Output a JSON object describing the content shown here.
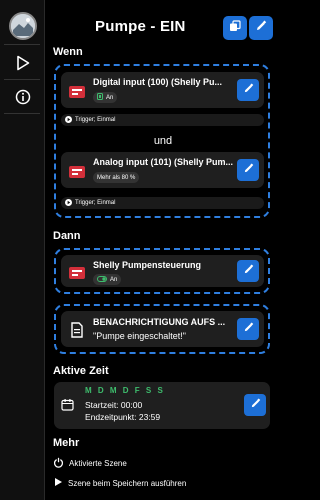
{
  "header": {
    "title": "Pumpe - EIN"
  },
  "sections": {
    "wenn": "Wenn",
    "dann": "Dann",
    "aktive_zeit": "Aktive Zeit",
    "mehr": "Mehr"
  },
  "conditions": [
    {
      "title": "Digital input (100) (Shelly Pu...",
      "badge": "An",
      "trigger": "Trigger; Einmal"
    },
    {
      "title": "Analog input (101) (Shelly Pum...",
      "badge": "Mehr als 80 %",
      "trigger": "Trigger; Einmal"
    }
  ],
  "connector": "und",
  "actions": [
    {
      "title": "Shelly Pumpensteuerung",
      "badge": "An"
    },
    {
      "title": "BENACHRICHTIGUNG AUFS ...",
      "subtitle": "\"Pumpe eingeschaltet!\""
    }
  ],
  "schedule": {
    "days": "M D M D F S S",
    "start": "Startzeit: 00:00",
    "end": "Endzeitpunkt: 23:59"
  },
  "more": {
    "activated": "Aktivierte Szene",
    "run_on_save": "Szene beim Speichern ausführen"
  },
  "colors": {
    "accent": "#1d6fd6",
    "dash": "#2f7fe0",
    "green": "#3ebd6d",
    "card": "#1f1f1f"
  },
  "icons": {
    "copy": "copy-icon",
    "edit": "pencil-icon",
    "play": "play-icon",
    "info": "info-icon",
    "power": "power-icon",
    "calendar": "calendar-icon",
    "document": "document-icon"
  }
}
